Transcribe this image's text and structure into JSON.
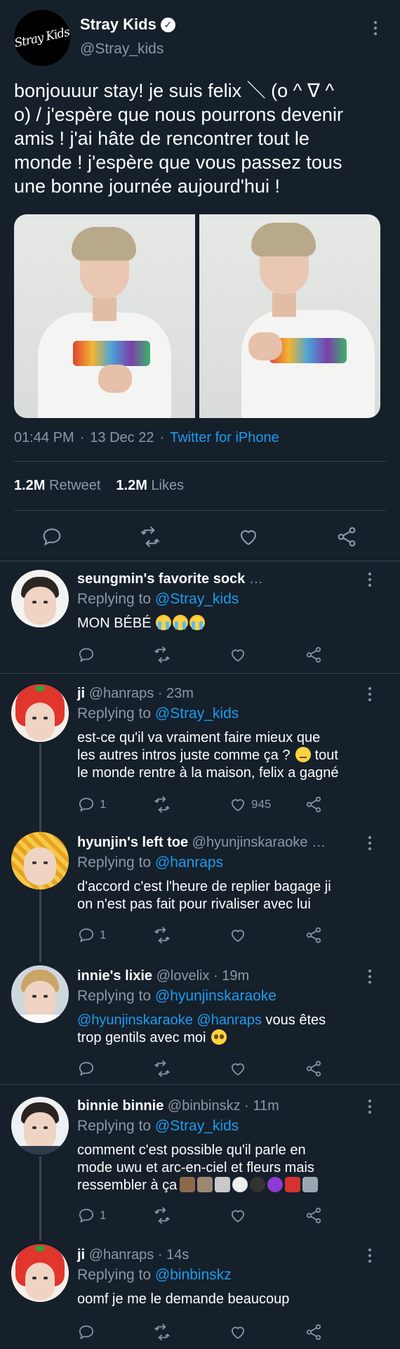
{
  "tweet": {
    "author_name": "Stray Kids",
    "author_handle": "@Stray_kids",
    "logo_text": "Stray Kids",
    "text": "bonjouuur stay! je suis felix ＼ (o ^ ∇ ^\no) / j'espère que nous pourrons devenir\namis ! j'ai hâte de rencontrer tout le\nmonde ! j'espère que vous passez tous\nune bonne journée aujourd'hui !",
    "time": "01:44 PM",
    "date": "13 Dec 22",
    "source": "Twitter for iPhone",
    "separator": "·",
    "retweets_count": "1.2M",
    "retweets_label": "Retweet",
    "likes_count": "1.2M",
    "likes_label": "Likes"
  },
  "replies": [
    {
      "name": "seungmin's favorite sock",
      "ellipsis": "…",
      "replying_label": "Replying to",
      "replying_to": "@Stray_kids",
      "text": "MON BÉBÉ",
      "reply_count": "",
      "like_count": ""
    },
    {
      "name": "ji",
      "handle": "@hanraps",
      "time": "23m",
      "replying_label": "Replying to",
      "replying_to": "@Stray_kids",
      "text_1": "est-ce qu'il va vraiment faire mieux que\nles autres intros juste comme ça ?",
      "text_2": " tout\nle monde rentre à la maison, felix a gagné",
      "reply_count": "1",
      "like_count": "945"
    },
    {
      "name": "hyunjin's left toe",
      "handle": "@hyunjinskaraoke",
      "ellipsis": "…",
      "replying_label": "Replying to",
      "replying_to": "@hanraps",
      "text": "d'accord c'est l'heure de replier bagage ji\non n'est pas fait pour rivaliser avec lui",
      "reply_count": "1"
    },
    {
      "name": "innie's lixie",
      "handle": "@lovelix",
      "time": "19m",
      "replying_label": "Replying to",
      "replying_to": "@hyunjinskaraoke",
      "mention_1": "@hyunjinskaraoke",
      "mention_2": "@hanraps",
      "text": " vous êtes\ntrop gentils avec moi"
    },
    {
      "name": "binnie binnie",
      "handle": "@binbinskz",
      "time": "11m",
      "replying_label": "Replying to",
      "replying_to": "@Stray_kids",
      "text": "comment c'est possible qu'il parle en\nmode uwu et arc-en-ciel et fleurs mais\nressembler à ça",
      "reply_count": "1"
    },
    {
      "name": "ji",
      "handle": "@hanraps",
      "time": "14s",
      "replying_label": "Replying to",
      "replying_to": "@binbinskz",
      "text": "oomf je me le demande beaucoup"
    }
  ],
  "colors": {
    "background": "#15202b",
    "link": "#1d9bf0",
    "muted": "#8b98a5",
    "divider": "#38444d"
  },
  "icons": [
    "reply-icon",
    "retweet-icon",
    "like-icon",
    "share-icon",
    "verified-icon",
    "more-icon"
  ]
}
